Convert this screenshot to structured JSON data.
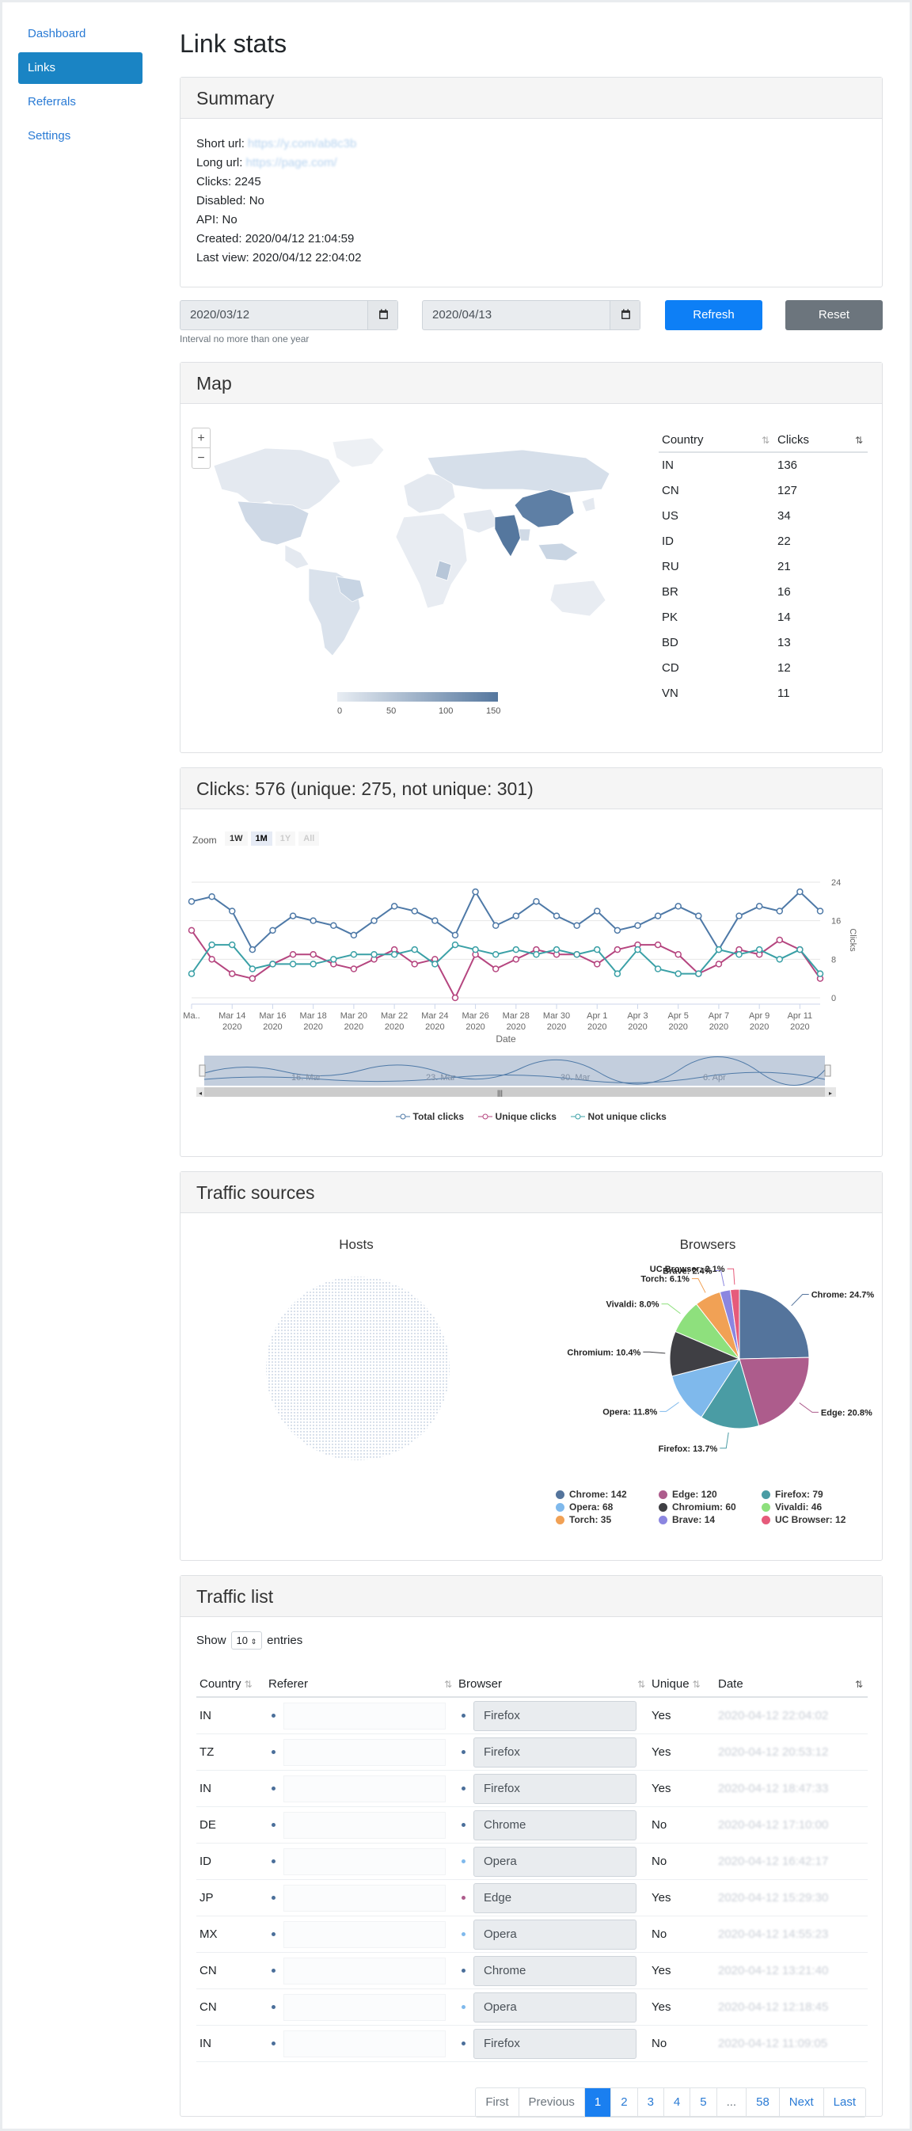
{
  "nav": [
    {
      "label": "Dashboard",
      "active": false
    },
    {
      "label": "Links",
      "active": true
    },
    {
      "label": "Referrals",
      "active": false
    },
    {
      "label": "Settings",
      "active": false
    }
  ],
  "page_title": "Link stats",
  "summary": {
    "title": "Summary",
    "short_url_label": "Short url:",
    "short_url": "https://y.com/ab8c3b",
    "long_url_label": "Long url:",
    "long_url": "https://page.com/",
    "clicks": "Clicks: 2245",
    "disabled": "Disabled: No",
    "api": "API: No",
    "created": "Created: 2020/04/12 21:04:59",
    "last_view": "Last view: 2020/04/12 22:04:02"
  },
  "filters": {
    "date_from": "2020/03/12",
    "date_to": "2020/04/13",
    "refresh": "Refresh",
    "reset": "Reset",
    "hint": "Interval no more than one year"
  },
  "map": {
    "title": "Map",
    "zoom_in": "+",
    "zoom_out": "−",
    "scale_ticks": [
      "0",
      "50",
      "100",
      "150"
    ],
    "table_headers": {
      "country": "Country",
      "clicks": "Clicks"
    },
    "rows": [
      {
        "country": "IN",
        "clicks": "136"
      },
      {
        "country": "CN",
        "clicks": "127"
      },
      {
        "country": "US",
        "clicks": "34"
      },
      {
        "country": "ID",
        "clicks": "22"
      },
      {
        "country": "RU",
        "clicks": "21"
      },
      {
        "country": "BR",
        "clicks": "16"
      },
      {
        "country": "PK",
        "clicks": "14"
      },
      {
        "country": "BD",
        "clicks": "13"
      },
      {
        "country": "CD",
        "clicks": "12"
      },
      {
        "country": "VN",
        "clicks": "11"
      }
    ]
  },
  "clicks_panel": {
    "title": "Clicks: 576 (unique: 275, not unique: 301)",
    "zoom_label": "Zoom",
    "zoom_buttons": [
      "1W",
      "1M",
      "1Y",
      "All"
    ],
    "navigator_labels": [
      "16. Mar",
      "23. Mar",
      "30. Mar",
      "6. Apr"
    ]
  },
  "chart_data": [
    {
      "type": "line",
      "title": "",
      "xlabel": "Date",
      "ylabel": "Clicks",
      "ylim": [
        0,
        24
      ],
      "y_ticks": [
        "0",
        "8",
        "16",
        "24"
      ],
      "x_tick_labels": [
        "Ma..",
        "Mar 14, 2020",
        "Mar 16, 2020",
        "Mar 18, 2020",
        "Mar 20, 2020",
        "Mar 22, 2020",
        "Mar 24, 2020",
        "Mar 26, 2020",
        "Mar 28, 2020",
        "Mar 30, 2020",
        "Apr 1, 2020",
        "Apr 3, 2020",
        "Apr 5, 2020",
        "Apr 7, 2020",
        "Apr 9, 2020",
        "Apr 11, 2020"
      ],
      "x": [
        "2020-03-12",
        "2020-03-13",
        "2020-03-14",
        "2020-03-15",
        "2020-03-16",
        "2020-03-17",
        "2020-03-18",
        "2020-03-19",
        "2020-03-20",
        "2020-03-21",
        "2020-03-22",
        "2020-03-23",
        "2020-03-24",
        "2020-03-25",
        "2020-03-26",
        "2020-03-27",
        "2020-03-28",
        "2020-03-29",
        "2020-03-30",
        "2020-03-31",
        "2020-04-01",
        "2020-04-02",
        "2020-04-03",
        "2020-04-04",
        "2020-04-05",
        "2020-04-06",
        "2020-04-07",
        "2020-04-08",
        "2020-04-09",
        "2020-04-10",
        "2020-04-11",
        "2020-04-12"
      ],
      "series": [
        {
          "name": "Total clicks",
          "color": "#4e79a7",
          "values": [
            20,
            21,
            18,
            10,
            14,
            17,
            16,
            15,
            13,
            16,
            19,
            18,
            16,
            13,
            22,
            15,
            17,
            20,
            17,
            15,
            18,
            14,
            15,
            17,
            19,
            17,
            10,
            17,
            19,
            18,
            22,
            18
          ]
        },
        {
          "name": "Unique clicks",
          "color": "#b5457f",
          "values": [
            14,
            8,
            5,
            4,
            7,
            9,
            9,
            7,
            6,
            8,
            10,
            7,
            8,
            0,
            9,
            6,
            8,
            10,
            9,
            9,
            7,
            10,
            11,
            11,
            9,
            5,
            7,
            10,
            9,
            12,
            10,
            4
          ]
        },
        {
          "name": "Not unique clicks",
          "color": "#3aa0a6",
          "values": [
            5,
            11,
            11,
            6,
            7,
            7,
            7,
            8,
            9,
            9,
            9,
            10,
            7,
            11,
            10,
            9,
            10,
            9,
            10,
            9,
            10,
            5,
            10,
            6,
            5,
            5,
            10,
            9,
            10,
            8,
            10,
            5
          ]
        }
      ]
    },
    {
      "type": "pie",
      "title": "Browsers",
      "series": [
        {
          "name": "Browsers",
          "values": [
            {
              "label": "Chrome",
              "value": 142,
              "pct": "24.7%",
              "color": "#54749c"
            },
            {
              "label": "Edge",
              "value": 120,
              "pct": "20.8%",
              "color": "#ad5c8c"
            },
            {
              "label": "Firefox",
              "value": 79,
              "pct": "13.7%",
              "color": "#4a9ca4"
            },
            {
              "label": "Opera",
              "value": 68,
              "pct": "11.8%",
              "color": "#7fb9ec"
            },
            {
              "label": "Chromium",
              "value": 60,
              "pct": "10.4%",
              "color": "#3f3f44"
            },
            {
              "label": "Vivaldi",
              "value": 46,
              "pct": "8.0%",
              "color": "#8ee07d"
            },
            {
              "label": "Torch",
              "value": 35,
              "pct": "6.1%",
              "color": "#f1a155"
            },
            {
              "label": "Brave",
              "value": 14,
              "pct": "2.4%",
              "color": "#8b86e0"
            },
            {
              "label": "UC Browser",
              "value": 12,
              "pct": "2.1%",
              "color": "#e65b7b"
            }
          ]
        }
      ]
    }
  ],
  "traffic_sources": {
    "title": "Traffic sources",
    "hosts_title": "Hosts",
    "browsers_title": "Browsers"
  },
  "traffic_list": {
    "title": "Traffic list",
    "show_label": "Show",
    "page_size": "10",
    "entries_label": "entries",
    "headers": {
      "country": "Country",
      "referer": "Referer",
      "browser": "Browser",
      "unique": "Unique",
      "date": "Date"
    },
    "rows": [
      {
        "country": "IN",
        "browser": "Firefox",
        "unique": "Yes",
        "date": "2020-04-12 22:04:02"
      },
      {
        "country": "TZ",
        "browser": "Firefox",
        "unique": "Yes",
        "date": "2020-04-12 20:53:12"
      },
      {
        "country": "IN",
        "browser": "Firefox",
        "unique": "Yes",
        "date": "2020-04-12 18:47:33"
      },
      {
        "country": "DE",
        "browser": "Chrome",
        "unique": "No",
        "date": "2020-04-12 17:10:00"
      },
      {
        "country": "ID",
        "browser": "Opera",
        "unique": "No",
        "date": "2020-04-12 16:42:17"
      },
      {
        "country": "JP",
        "browser": "Edge",
        "unique": "Yes",
        "date": "2020-04-12 15:29:30"
      },
      {
        "country": "MX",
        "browser": "Opera",
        "unique": "No",
        "date": "2020-04-12 14:55:23"
      },
      {
        "country": "CN",
        "browser": "Chrome",
        "unique": "Yes",
        "date": "2020-04-12 13:21:40"
      },
      {
        "country": "CN",
        "browser": "Opera",
        "unique": "Yes",
        "date": "2020-04-12 12:18:45"
      },
      {
        "country": "IN",
        "browser": "Firefox",
        "unique": "No",
        "date": "2020-04-12 11:09:05"
      }
    ],
    "pagination": [
      "First",
      "Previous",
      "1",
      "2",
      "3",
      "4",
      "5",
      "...",
      "58",
      "Next",
      "Last"
    ]
  }
}
